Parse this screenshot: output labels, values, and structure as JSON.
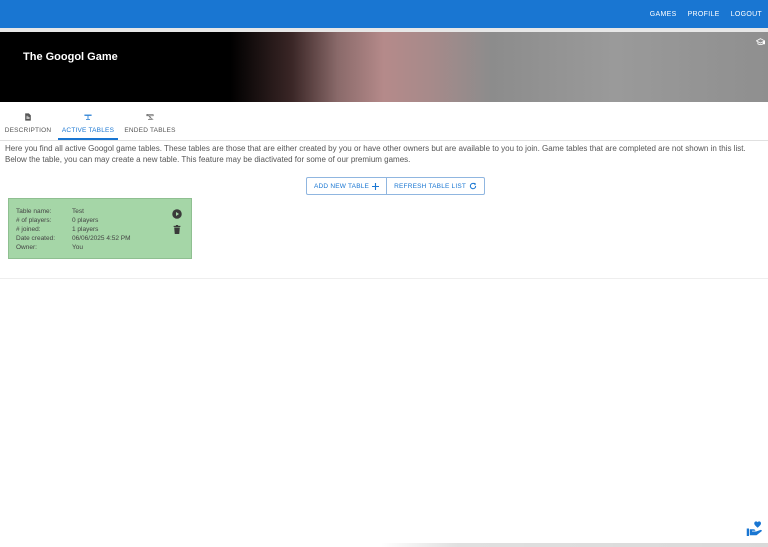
{
  "nav": {
    "items": [
      "GAMES",
      "PROFILE",
      "LOGOUT"
    ]
  },
  "hero": {
    "title": "The Googol Game",
    "icon": "graduation-cap-icon"
  },
  "tabs": [
    {
      "label": "DESCRIPTION",
      "icon": "document-icon",
      "active": false
    },
    {
      "label": "ACTIVE TABLES",
      "icon": "table-icon",
      "active": true
    },
    {
      "label": "ENDED TABLES",
      "icon": "table-off-icon",
      "active": false
    }
  ],
  "description": "Here you find all active Googol game tables. These tables are those that are either created by you or have other owners but are available to you to join. Game tables that are completed are not shown in this list. Below the table, you can may create a new table. This feature may be diactivated for some of our premium games.",
  "actions": {
    "add_label": "ADD NEW TABLE",
    "refresh_label": "REFRESH TABLE LIST"
  },
  "card": {
    "fields": [
      {
        "label": "Table name:",
        "value": "Test"
      },
      {
        "label": "# of players:",
        "value": "0 players"
      },
      {
        "label": "# joined:",
        "value": "1 players"
      },
      {
        "label": "Date created:",
        "value": "06/06/2025 4:52 PM"
      },
      {
        "label": "Owner:",
        "value": "You"
      }
    ],
    "background": "#a5d6a7"
  },
  "colors": {
    "primary": "#1976d2",
    "card": "#a5d6a7"
  }
}
